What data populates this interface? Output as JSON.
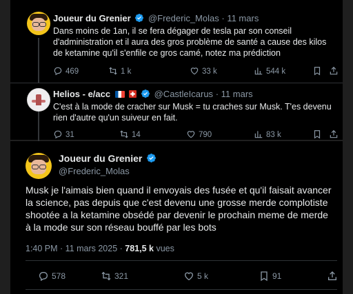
{
  "tweets": [
    {
      "name": "Joueur du Grenier",
      "handle": "@Frederic_Molas",
      "time": "11 mars",
      "text": "Dans moins de 1an, il se fera dégager de tesla par son conseil d'administration et il aura des gros problème de santé a cause des kilos de ketamine qu'il s'enfile ce gros camé, notez ma prédiction",
      "replies": "469",
      "reposts": "1 k",
      "likes": "33 k",
      "views": "544 k"
    },
    {
      "name": "Helios - e/acc",
      "handle": "@CastleIcarus",
      "time": "11 mars",
      "text": "C'est à la mode de cracher sur Musk = tu craches sur Musk. T'es devenu rien d'autre qu'un suiveur en fait.",
      "replies": "31",
      "reposts": "14",
      "likes": "790",
      "views": "83 k"
    }
  ],
  "main": {
    "name": "Joueur du Grenier",
    "handle": "@Frederic_Molas",
    "text": "Musk je l'aimais bien quand il envoyais des fusée et qu'il faisait avancer la science, pas depuis que c'est devenu une grosse merde complotiste shootée a la ketamine obsédé par devenir le prochain meme de merde à la mode sur son réseau bouffé par les bots",
    "timestamp": "1:40 PM · 11 mars 2025 · ",
    "views_count": "781,5 k",
    "views_label": " vues",
    "replies": "578",
    "reposts": "321",
    "likes": "5 k",
    "bookmarks": "91"
  },
  "separator": "·",
  "colors": {
    "verified": "#1d9bf0",
    "muted": "#8b98a5",
    "text": "#e7e9ea"
  },
  "icons": [
    "reply-icon",
    "repost-icon",
    "like-icon",
    "views-icon",
    "bookmark-icon",
    "share-icon",
    "verified-badge-icon"
  ]
}
